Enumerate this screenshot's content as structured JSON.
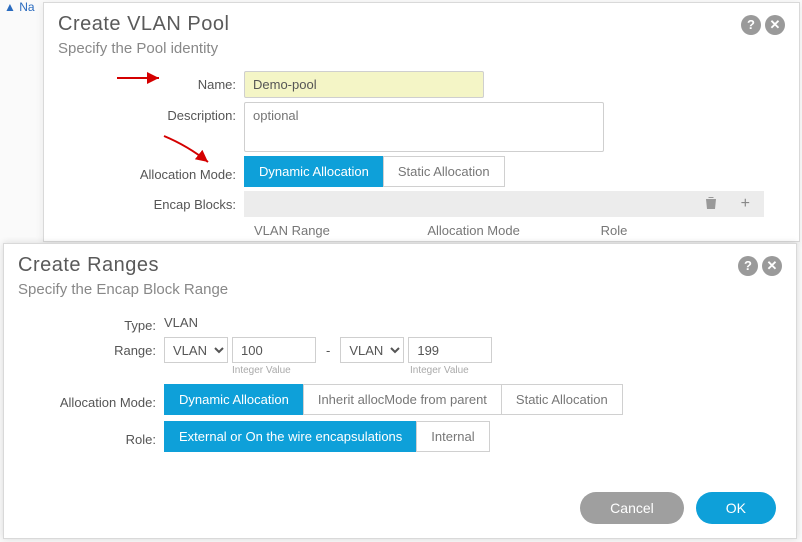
{
  "pool": {
    "title": "Create VLAN Pool",
    "subtitle": "Specify the Pool identity",
    "labels": {
      "name": "Name:",
      "description": "Description:",
      "allocMode": "Allocation Mode:",
      "encapBlocks": "Encap Blocks:"
    },
    "nameValue": "Demo-pool",
    "descPlaceholder": "optional",
    "allocOptions": {
      "dynamic": "Dynamic Allocation",
      "static": "Static Allocation"
    },
    "tableCols": {
      "vlanRange": "VLAN Range",
      "allocMode": "Allocation Mode",
      "role": "Role"
    },
    "icons": {
      "trash": "trash-icon",
      "plus": "plus-icon"
    }
  },
  "ranges": {
    "title": "Create Ranges",
    "subtitle": "Specify the Encap Block Range",
    "labels": {
      "type": "Type:",
      "range": "Range:",
      "allocMode": "Allocation Mode:",
      "role": "Role:"
    },
    "typeValue": "VLAN",
    "rangeFromType": "VLAN",
    "rangeFromValue": "100",
    "rangeDash": "-",
    "rangeToType": "VLAN",
    "rangeToValue": "199",
    "intLabel": "Integer Value",
    "allocOptions": {
      "dynamic": "Dynamic Allocation",
      "inherit": "Inherit allocMode from parent",
      "static": "Static Allocation"
    },
    "roleOptions": {
      "external": "External or On the wire encapsulations",
      "internal": "Internal"
    },
    "buttons": {
      "cancel": "Cancel",
      "ok": "OK"
    }
  },
  "header": {
    "help": "?",
    "close": "✕"
  }
}
